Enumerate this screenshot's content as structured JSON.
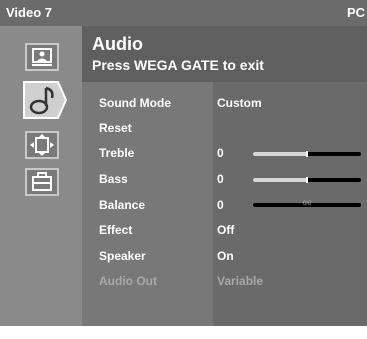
{
  "status_bar": {
    "input": "Video 7",
    "mode": "PC"
  },
  "menu": {
    "title": "Audio",
    "subtitle": "Press WEGA GATE to exit",
    "icons": [
      "picture-icon",
      "audio-icon",
      "screen-icon",
      "setup-icon"
    ],
    "selected_icon": "audio-icon",
    "items": [
      {
        "label": "Sound Mode",
        "value": "Custom",
        "enabled": true
      },
      {
        "label": "Reset",
        "value": "",
        "enabled": true
      },
      {
        "label": "Treble",
        "value": "0",
        "enabled": true,
        "slider_level": 0.5
      },
      {
        "label": "Bass",
        "value": "0",
        "enabled": true,
        "slider_level": 0.5
      },
      {
        "label": "Balance",
        "value": "0",
        "enabled": true,
        "slider_level": 0.5,
        "slider_center_mark": "0/0"
      },
      {
        "label": "Effect",
        "value": "Off",
        "enabled": true
      },
      {
        "label": "Speaker",
        "value": "On",
        "enabled": true
      },
      {
        "label": "Audio Out",
        "value": "Variable",
        "enabled": false
      }
    ]
  },
  "colors": {
    "status_bar": "#6b6b6b",
    "sidebar": "#8a8a8a",
    "panel": "#6f6f6f",
    "text": "#ffffff",
    "disabled_text": "#a8a8a8"
  }
}
